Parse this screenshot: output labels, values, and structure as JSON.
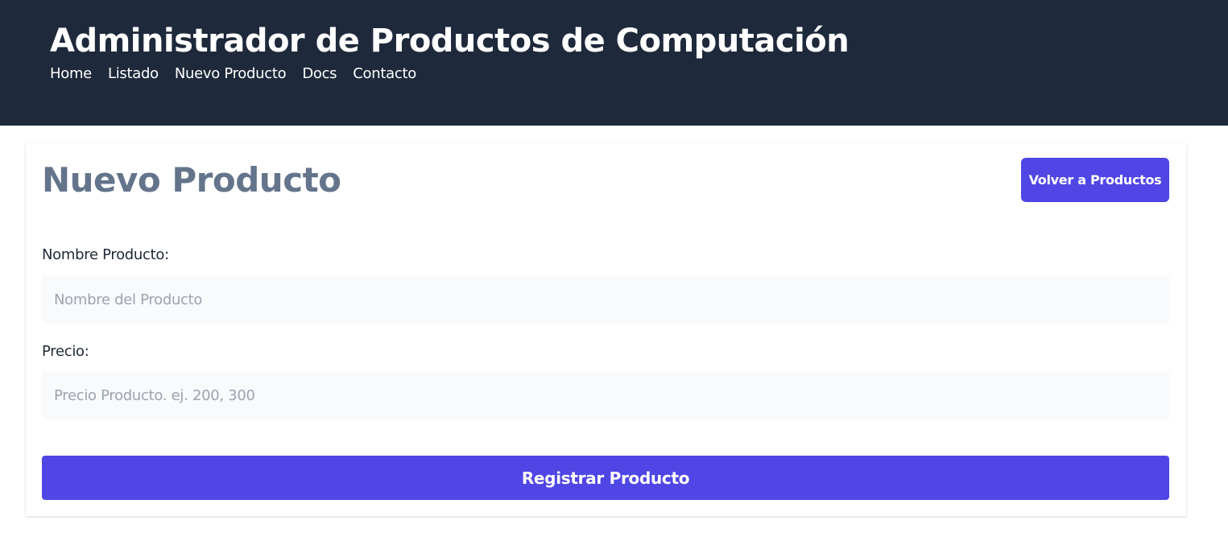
{
  "header": {
    "title": "Administrador de Productos de Computación",
    "nav": [
      "Home",
      "Listado",
      "Nuevo Producto",
      "Docs",
      "Contacto"
    ]
  },
  "main": {
    "title": "Nuevo Producto",
    "back_label": "Volver a Productos",
    "fields": [
      {
        "label": "Nombre Producto:",
        "placeholder": "Nombre del Producto",
        "value": ""
      },
      {
        "label": "Precio:",
        "placeholder": "Precio Producto. ej. 200, 300",
        "value": ""
      }
    ],
    "submit_label": "Registrar Producto"
  },
  "colors": {
    "header_bg": "#1e293b",
    "accent": "#4f46e5",
    "title": "#64748b"
  }
}
